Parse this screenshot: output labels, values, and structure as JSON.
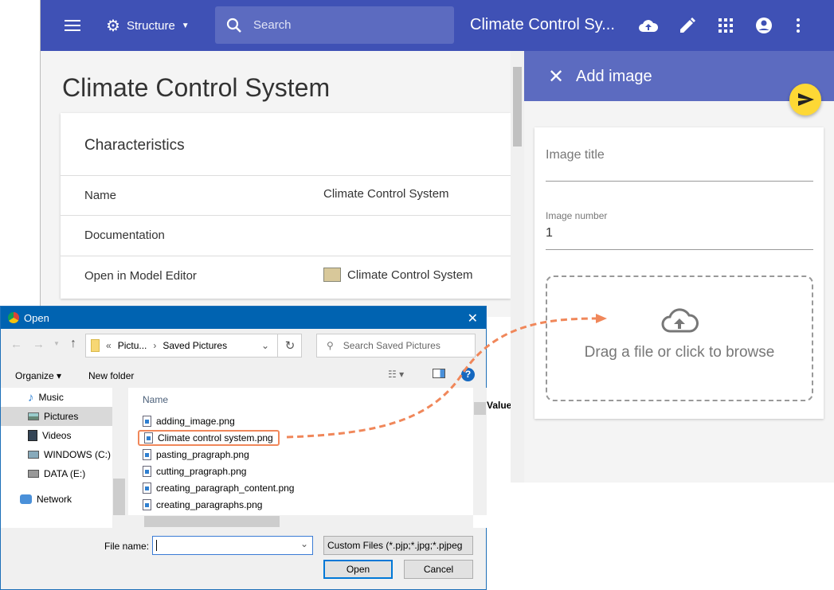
{
  "topbar": {
    "structure_label": "Structure",
    "search_placeholder": "Search",
    "title": "Climate Control Sy..."
  },
  "main": {
    "page_title": "Climate Control System",
    "card_title": "Characteristics",
    "rows": [
      {
        "key": "Name",
        "value": "Climate Control System"
      },
      {
        "key": "Documentation",
        "value": ""
      },
      {
        "key": "Open in Model Editor",
        "value": "Climate Control System"
      }
    ],
    "partial_column": "Value"
  },
  "panel": {
    "title": "Add image",
    "image_title_placeholder": "Image title",
    "image_number_label": "Image number",
    "image_number_value": "1",
    "drop_text": "Drag a file or click to browse"
  },
  "dialog": {
    "title": "Open",
    "breadcrumb_parent": "Pictu...",
    "breadcrumb_current": "Saved Pictures",
    "search_placeholder": "Search Saved Pictures",
    "organize": "Organize",
    "new_folder": "New folder",
    "nav": [
      "Music",
      "Pictures",
      "Videos",
      "WINDOWS (C:)",
      "DATA (E:)",
      "Network"
    ],
    "column_name": "Name",
    "files": [
      "adding_image.png",
      "Climate control system.png",
      "pasting_pragraph.png",
      "cutting_pragraph.png",
      "creating_paragraph_content.png",
      "creating_paragraphs.png"
    ],
    "file_name_label": "File name:",
    "file_name_value": "",
    "filter": "Custom Files (*.pjp;*.jpg;*.pjpeg",
    "open": "Open",
    "cancel": "Cancel"
  },
  "colors": {
    "primary": "#3f51b5",
    "panel_header": "#5c6bc0",
    "fab": "#fdd835",
    "highlight": "#f0875a",
    "dialog_title": "#0063b1"
  }
}
